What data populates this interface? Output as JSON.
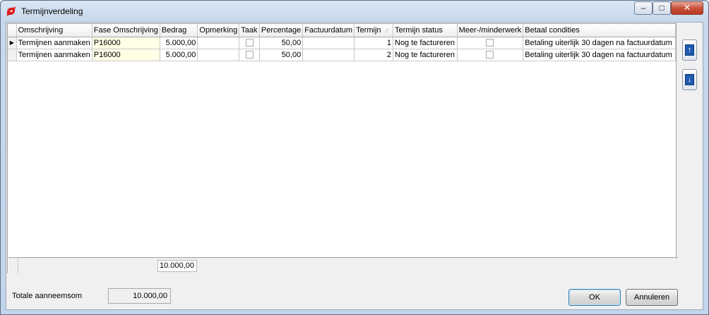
{
  "window": {
    "title": "Termijnverdeling",
    "controls": {
      "minimize": "–",
      "maximize": "□",
      "close": "✕"
    }
  },
  "grid": {
    "columns": [
      "Omschrijving",
      "Fase Omschrijving",
      "Bedrag",
      "Opmerking",
      "Taak",
      "Percentage",
      "Factuurdatum",
      "Termijn",
      "Termijn status",
      "Meer-/minderwerk",
      "Betaal condities"
    ],
    "rows": [
      {
        "indicator": "▶",
        "omschrijving": "Termijnen aanmaken",
        "fase": "P16000",
        "bedrag": "5.000,00",
        "opmerking": "",
        "percentage": "50,00",
        "factuurdatum": "",
        "termijn": "1",
        "status": "Nog te factureren",
        "condities": "Betaling uiterlijk 30 dagen na factuurdatum"
      },
      {
        "indicator": "",
        "omschrijving": "Termijnen aanmaken",
        "fase": "P16000",
        "bedrag": "5.000,00",
        "opmerking": "",
        "percentage": "50,00",
        "factuurdatum": "",
        "termijn": "2",
        "status": "Nog te factureren",
        "condities": "Betaling uiterlijk 30 dagen na factuurdatum"
      }
    ],
    "footer_total": "10.000,00"
  },
  "side_buttons": {
    "move_up_icon": "arrow-up",
    "move_down_icon": "arrow-down",
    "up_glyph": "↑",
    "down_glyph": "↓"
  },
  "bottom": {
    "total_label": "Totale aanneemsom",
    "total_value": "10.000,00",
    "ok_label": "OK",
    "cancel_label": "Annuleren"
  },
  "colors": {
    "fase_cell_bg": "#ffffe6",
    "close_button": "#c9503a",
    "move_button": "#1e5bb0"
  }
}
